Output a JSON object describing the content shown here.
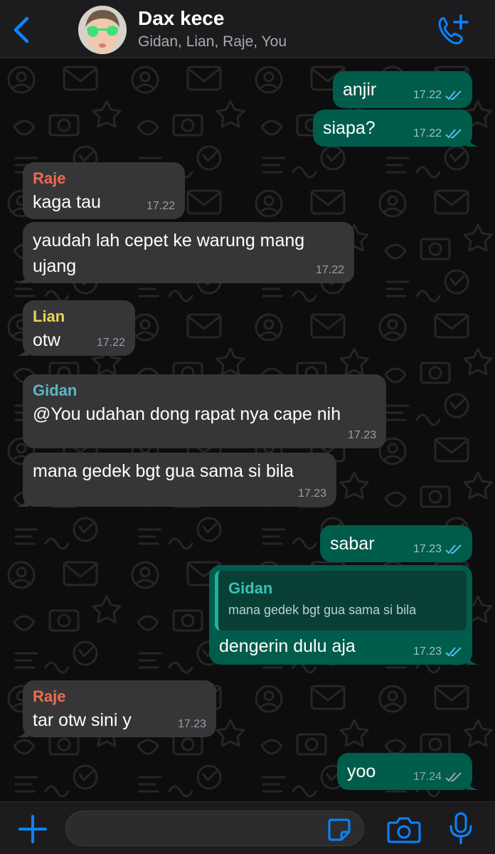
{
  "header": {
    "title": "Dax kece",
    "members": "Gidan, Lian, Raje, You"
  },
  "colors": {
    "accent": "#0a84ff",
    "outgoing_bubble": "#005c4b",
    "incoming_bubble": "#363638",
    "read_tick": "#53bdeb",
    "sender_raje": "#f06a4e",
    "sender_lian": "#e3d955",
    "sender_gidan": "#5bb7c6"
  },
  "messages": [
    {
      "direction": "out",
      "text": "anjir",
      "time": "17.22",
      "status": "read"
    },
    {
      "direction": "out",
      "text": "siapa?",
      "time": "17.22",
      "status": "read"
    },
    {
      "direction": "in",
      "sender": "Raje",
      "text": "kaga tau",
      "time": "17.22"
    },
    {
      "direction": "in",
      "text": "yaudah lah cepet ke warung mang\nujang",
      "time": "17.22"
    },
    {
      "direction": "in",
      "sender": "Lian",
      "text": "otw",
      "time": "17.22"
    },
    {
      "direction": "in",
      "sender": "Gidan",
      "text": "@You udahan dong rapat nya cape nih",
      "time": "17.23"
    },
    {
      "direction": "in",
      "text": "mana gedek bgt gua sama si bila",
      "time": "17.23"
    },
    {
      "direction": "out",
      "text": "sabar",
      "time": "17.23",
      "status": "read"
    },
    {
      "direction": "out",
      "reply_to": {
        "sender": "Gidan",
        "text": "mana gedek bgt gua sama si bila"
      },
      "text": "dengerin dulu aja",
      "time": "17.23",
      "status": "read"
    },
    {
      "direction": "in",
      "sender": "Raje",
      "text": "tar otw sini y",
      "time": "17.23"
    },
    {
      "direction": "out",
      "text": "yoo",
      "time": "17.24",
      "status": "delivered"
    }
  ],
  "input": {
    "value": "",
    "placeholder": ""
  },
  "icons": {
    "back": "chevron-left-icon",
    "call": "add-call-icon",
    "attach": "plus-icon",
    "sticker": "sticker-icon",
    "camera": "camera-icon",
    "mic": "microphone-icon"
  }
}
